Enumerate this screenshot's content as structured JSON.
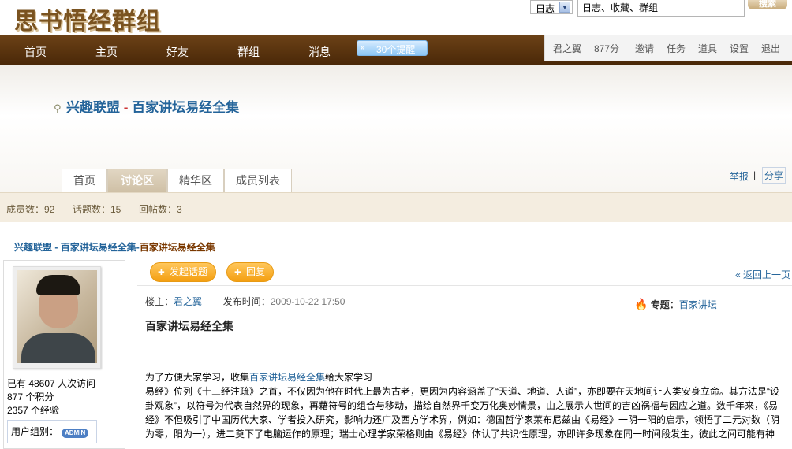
{
  "logo": "思书悟经群组",
  "search": {
    "scope": "日志",
    "value": "日志、收藏、群组",
    "button": "搜索"
  },
  "nav": {
    "items": [
      "首页",
      "主页",
      "好友",
      "群组",
      "消息"
    ],
    "reminder": "30个提醒",
    "user": "君之翼",
    "score": "877分",
    "right": [
      "邀请",
      "任务",
      "道具",
      "设置",
      "退出"
    ]
  },
  "group": {
    "category": "兴趣联盟",
    "dash": " - ",
    "name": "百家讲坛易经全集",
    "tabs": [
      "首页",
      "讨论区",
      "精华区",
      "成员列表"
    ],
    "active_tab": 1,
    "report": "举报",
    "separator": "|",
    "share": "分享"
  },
  "stats": {
    "members": "成员数：92",
    "topics": "话题数：15",
    "replies": "回帖数：3"
  },
  "breadcrumb": {
    "a": "兴趣联盟",
    "sep1": " - ",
    "b": "百家讲坛易经全集",
    "sep2": "-",
    "c": "百家讲坛易经全集"
  },
  "profile": {
    "visits": "已有 48607 人次访问",
    "points": "877 个积分",
    "exp": "2357 个经验",
    "group_label": "用户组别：",
    "badge": "ADMIN"
  },
  "post": {
    "new_topic": "发起话题",
    "reply": "回复",
    "back": "« 返回上一页",
    "owner_label": "楼主：",
    "owner": "君之翼",
    "time_label": "发布时间：",
    "time": "2009-10-22 17:50",
    "topic_label": "专题：",
    "topic": "百家讲坛",
    "title": "百家讲坛易经全集",
    "line1_a": "为了方便大家学习，收集",
    "line1_link": "百家讲坛易经全集",
    "line1_b": "给大家学习",
    "paragraph": "易经》位列《十三经注疏》之首，不仅因为他在时代上最为古老，更因为内容涵盖了“天道、地道、人道”，亦即要在天地间让人类安身立命。其方法是“设卦观象”，以符号为代表自然界的现象，再藉符号的组合与移动，描绘自然界千变万化奥妙情景，由之展示人世间的吉凶祸福与因应之道。数千年来，《易经》不但吸引了中国历代大家、学者投入研究，影响力还广及西方学术界，例如：德国哲学家莱布尼兹由《易经》一阴一阳的启示，领悟了二元对数（阴为零，阳为一），进二奠下了电脑运作的原理；瑞士心理学家荣格则由《易经》体认了共识性原理，亦即许多现象在同一时间段发生，彼此之间可能有神"
  }
}
